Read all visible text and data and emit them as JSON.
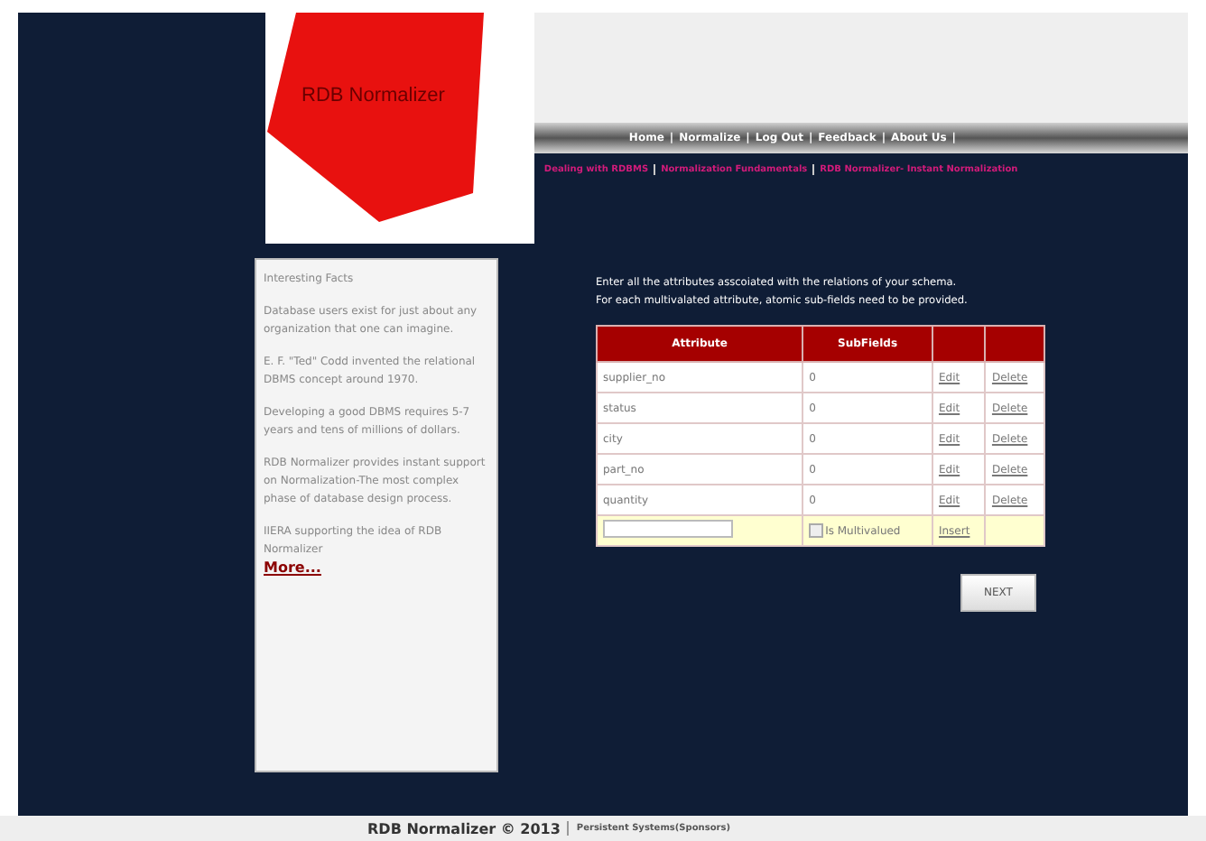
{
  "logo": {
    "title": "RDB Normalizer"
  },
  "nav": {
    "separator": "|",
    "links": [
      "Home",
      "Normalize",
      "Log Out",
      "Feedback",
      "About Us"
    ]
  },
  "subnav": [
    "Dealing with RDBMS",
    "Normalization Fundamentals",
    "RDB Normalizer- Instant Normalization"
  ],
  "sidebar": {
    "heading": "Interesting Facts",
    "facts": [
      "Database users exist for just about any organization that one can imagine.",
      "E. F. \"Ted\" Codd invented the relational DBMS concept around 1970.",
      "Developing a good DBMS requires 5-7 years and tens of millions of dollars.",
      "RDB Normalizer provides instant support on Normalization-The most complex phase of database design process.",
      "IIERA supporting the idea of RDB Normalizer"
    ],
    "more": "More..."
  },
  "instructions": [
    "Enter all the attributes asscoiated with the relations of your schema.",
    "For each multivalated attribute, atomic sub-fields need to be provided."
  ],
  "table": {
    "columns": [
      "Attribute",
      "SubFields"
    ],
    "rows": [
      {
        "attribute": "supplier_no",
        "subfields": "0",
        "edit": "Edit",
        "delete": "Delete"
      },
      {
        "attribute": "status",
        "subfields": "0",
        "edit": "Edit",
        "delete": "Delete"
      },
      {
        "attribute": "city",
        "subfields": "0",
        "edit": "Edit",
        "delete": "Delete"
      },
      {
        "attribute": "part_no",
        "subfields": "0",
        "edit": "Edit",
        "delete": "Delete"
      },
      {
        "attribute": "quantity",
        "subfields": "0",
        "edit": "Edit",
        "delete": "Delete"
      }
    ],
    "new_row": {
      "multivalued_label": "Is Multivalued",
      "checked": false,
      "insert": "Insert"
    }
  },
  "next_button": "NEXT",
  "footer": {
    "title": "RDB Normalizer © 2013",
    "sponsor": "Persistent Systems(Sponsors)"
  }
}
